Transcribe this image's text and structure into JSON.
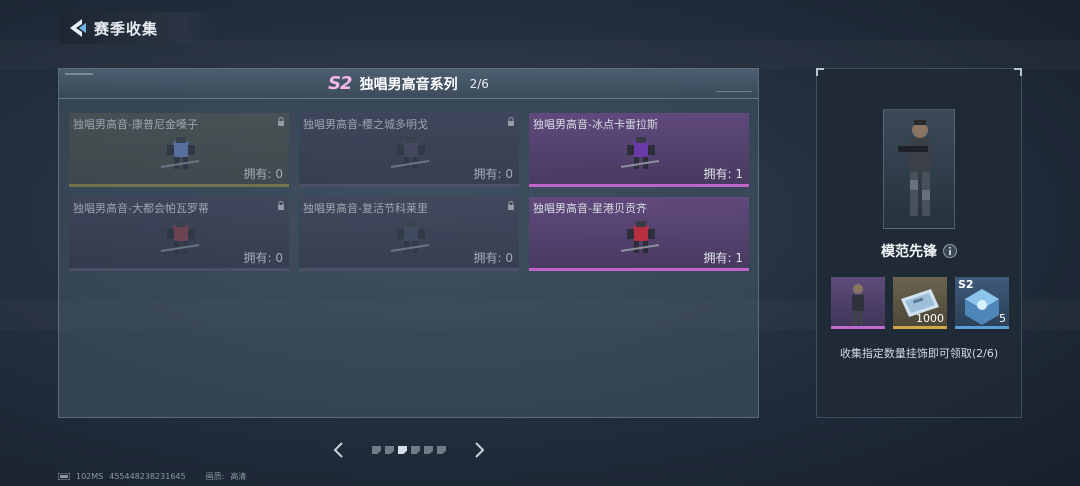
{
  "header": {
    "title": "赛季收集"
  },
  "series": {
    "season": "S2",
    "title": "独唱男高音系列",
    "progress": "2/6"
  },
  "cards": [
    {
      "name": "独唱男高音-康普尼金嗓子",
      "owned": "拥有: 0",
      "locked": true,
      "tier": "gold",
      "mech_color": "#6b86c8"
    },
    {
      "name": "独唱男高音-樱之城多明戈",
      "owned": "拥有: 0",
      "locked": true,
      "tier": "normal",
      "mech_color": "#4a4560"
    },
    {
      "name": "独唱男高音-冰点卡雷拉斯",
      "owned": "拥有: 1",
      "locked": false,
      "tier": "owned",
      "mech_color": "#6a3aa8"
    },
    {
      "name": "独唱男高音-大都会帕瓦罗蒂",
      "owned": "拥有: 0",
      "locked": true,
      "tier": "normal",
      "mech_color": "#8a4050"
    },
    {
      "name": "独唱男高音-复活节科莱里",
      "owned": "拥有: 0",
      "locked": true,
      "tier": "normal",
      "mech_color": "#3e4860"
    },
    {
      "name": "独唱男高音-星港贝贡齐",
      "owned": "拥有: 1",
      "locked": false,
      "tier": "owned",
      "mech_color": "#b83040"
    }
  ],
  "pagination": {
    "total": 6,
    "active": 2
  },
  "reward": {
    "hero_name": "模范先锋",
    "items": [
      {
        "icon": "hero-outfit-icon",
        "qty": "",
        "season": "",
        "tier": "purple"
      },
      {
        "icon": "ticket-icon",
        "qty": "1000",
        "season": "",
        "tier": "gold"
      },
      {
        "icon": "supply-crate-icon",
        "qty": "5",
        "season": "S2",
        "tier": "blue"
      }
    ],
    "description": "收集指定数量挂饰即可领取(2/6)"
  },
  "status": {
    "ping": "102MS",
    "uid": "455448238231645",
    "quality_label": "画质:",
    "quality_value": "高清"
  },
  "colors": {
    "accent_pink": "#f4b8e4",
    "owned_bar": "#c063c8",
    "gold_bar": "#9b8a4a"
  }
}
